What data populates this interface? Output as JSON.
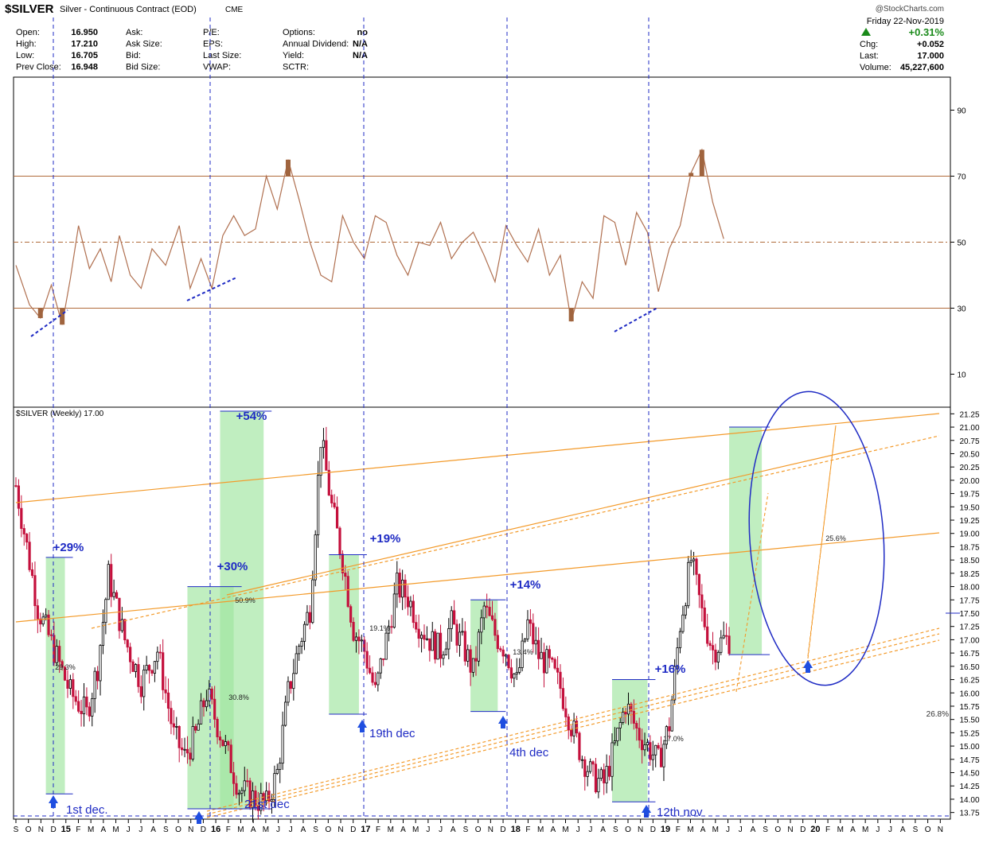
{
  "header": {
    "symbol": "$SILVER",
    "description": "Silver - Continuous Contract (EOD)",
    "exchange": "CME",
    "watermark": "@StockCharts.com",
    "date": "Friday  22-Nov-2019",
    "change_pct": "+0.31%",
    "change_icon": "up-triangle-icon",
    "stats_left": [
      {
        "label": "Open:",
        "value": "16.950"
      },
      {
        "label": "High:",
        "value": "17.210"
      },
      {
        "label": "Low:",
        "value": "16.705"
      },
      {
        "label": "Prev Close:",
        "value": "16.948"
      }
    ],
    "stats_mid": [
      {
        "label": "Ask:",
        "value": ""
      },
      {
        "label": "Ask Size:",
        "value": ""
      },
      {
        "label": "Bid:",
        "value": ""
      },
      {
        "label": "Bid Size:",
        "value": ""
      }
    ],
    "stats_mid2": [
      {
        "label": "P/E:",
        "value": ""
      },
      {
        "label": "EPS:",
        "value": ""
      },
      {
        "label": "Last Size:",
        "value": ""
      },
      {
        "label": "VWAP:",
        "value": ""
      }
    ],
    "stats_mid3": [
      {
        "label": "Options:",
        "value": "no"
      },
      {
        "label": "Annual Dividend:",
        "value": "N/A"
      },
      {
        "label": "Yield:",
        "value": "N/A"
      },
      {
        "label": "SCTR:",
        "value": ""
      }
    ],
    "stats_right": [
      {
        "label": "Chg:",
        "value": "+0.052"
      },
      {
        "label": "Last:",
        "value": "17.000"
      },
      {
        "label": "Volume:",
        "value": "45,227,600"
      }
    ]
  },
  "colors": {
    "rsi_line": "#b07050",
    "orange": "#f39a2a",
    "blue_text": "#1f2bc4",
    "green_box": "#9ee59e",
    "bar_red": "#c4103c",
    "bar_black": "#000000",
    "frame": "#000000"
  },
  "chart_data": [
    {
      "type": "line",
      "name": "rsi_panel",
      "y_ticks": [
        "90",
        "70",
        "50",
        "30",
        "10"
      ],
      "y_tick_values": [
        90,
        70,
        50,
        30,
        10
      ],
      "ylim": [
        0,
        100
      ],
      "overbought": 70,
      "oversold": 30,
      "midline": 50,
      "x": [
        0,
        5,
        9,
        13,
        17,
        20,
        23,
        27,
        31,
        35,
        38,
        42,
        46,
        50,
        55,
        60,
        64,
        68,
        72,
        76,
        80,
        84,
        88,
        92,
        96,
        100,
        104,
        108,
        112,
        116,
        120,
        124,
        128,
        132,
        136,
        140,
        144,
        148,
        152,
        156,
        160,
        164,
        168,
        172,
        176,
        180,
        184,
        188,
        192,
        196,
        200,
        204,
        208,
        212,
        216,
        220,
        224,
        228,
        232,
        236,
        240,
        244,
        248,
        252,
        256,
        260
      ],
      "values": [
        43,
        31,
        27,
        37,
        25,
        39,
        55,
        42,
        48,
        38,
        52,
        40,
        36,
        48,
        43,
        55,
        36,
        45,
        36,
        52,
        58,
        52,
        54,
        70,
        60,
        75,
        63,
        50,
        40,
        38,
        58,
        50,
        45,
        58,
        56,
        46,
        40,
        50,
        49,
        56,
        45,
        50,
        53,
        46,
        38,
        55,
        49,
        44,
        54,
        40,
        46,
        26,
        38,
        33,
        58,
        56,
        43,
        59,
        53,
        35,
        48,
        55,
        71,
        78,
        62,
        51
      ]
    },
    {
      "type": "bar",
      "name": "SILVER weekly price",
      "series_label": "$SILVER (Weekly) 17.00",
      "y_ticks": [
        "21.25",
        "21.00",
        "20.75",
        "20.50",
        "20.25",
        "20.00",
        "19.75",
        "19.50",
        "19.25",
        "19.00",
        "18.75",
        "18.50",
        "18.25",
        "18.00",
        "17.75",
        "17.50",
        "17.25",
        "17.00",
        "16.75",
        "16.50",
        "16.25",
        "16.00",
        "15.75",
        "15.50",
        "15.25",
        "15.00",
        "14.75",
        "14.50",
        "14.25",
        "14.00",
        "13.75"
      ],
      "ylim": [
        13.7,
        21.3
      ],
      "x_ticks": [
        "S",
        "O",
        "N",
        "D",
        "15",
        "F",
        "M",
        "A",
        "M",
        "J",
        "J",
        "A",
        "S",
        "O",
        "N",
        "D",
        "16",
        "F",
        "M",
        "A",
        "M",
        "J",
        "J",
        "A",
        "S",
        "O",
        "N",
        "D",
        "17",
        "F",
        "M",
        "A",
        "M",
        "J",
        "J",
        "A",
        "S",
        "O",
        "N",
        "D",
        "18",
        "F",
        "M",
        "A",
        "M",
        "J",
        "J",
        "A",
        "S",
        "O",
        "N",
        "D",
        "19",
        "F",
        "M",
        "A",
        "M",
        "J",
        "J",
        "A",
        "S",
        "O",
        "N",
        "D",
        "20",
        "F",
        "M",
        "A",
        "M",
        "J",
        "J",
        "A",
        "S",
        "O",
        "N"
      ],
      "weeks": [
        0,
        8,
        14,
        20,
        26,
        30,
        34,
        40,
        46,
        52,
        58,
        62,
        66,
        70,
        76,
        82,
        88,
        92,
        96,
        100,
        104,
        108,
        112,
        116,
        120,
        124,
        128,
        132,
        136,
        140,
        144,
        148,
        152,
        156,
        160,
        164,
        168,
        172,
        176,
        180,
        184,
        188,
        192,
        196,
        200,
        204,
        208,
        212,
        216,
        220,
        224,
        228,
        232,
        236,
        240,
        244,
        248,
        252,
        256,
        260,
        262
      ],
      "close": [
        19.9,
        17.6,
        16.8,
        16.0,
        15.6,
        16.5,
        18.2,
        17.0,
        16.2,
        16.8,
        15.2,
        14.8,
        15.2,
        16.0,
        15.1,
        14.2,
        14.0,
        13.9,
        14.5,
        16.0,
        16.9,
        17.6,
        20.8,
        19.5,
        18.5,
        17.2,
        16.8,
        16.0,
        17.0,
        18.0,
        17.8,
        17.3,
        17.0,
        16.8,
        17.3,
        16.9,
        16.4,
        17.6,
        17.1,
        16.8,
        16.2,
        17.3,
        16.7,
        16.5,
        16.1,
        15.4,
        14.8,
        14.4,
        14.3,
        15.0,
        15.8,
        15.3,
        15.0,
        14.7,
        15.4,
        17.3,
        18.5,
        17.5,
        16.8,
        17.0,
        17.0
      ],
      "measure_boxes": [
        {
          "label": "+29%",
          "inner": "29.3%",
          "marker": "1st dec.",
          "start_week": 11,
          "end_week": 18,
          "low": 14.1,
          "high": 18.55
        },
        {
          "label": "+30%",
          "inner": "30.8%",
          "marker": "21st dec",
          "start_week": 63,
          "end_week": 80,
          "low": 13.82,
          "high": 18.0
        },
        {
          "label": "+54%",
          "inner": "50.9%",
          "marker": "",
          "start_week": 75,
          "end_week": 91,
          "low": 13.82,
          "high": 21.3
        },
        {
          "label": "+19%",
          "inner": "19.1%",
          "marker": "19th dec",
          "start_week": 115,
          "end_week": 126,
          "low": 15.6,
          "high": 18.6
        },
        {
          "label": "+14%",
          "inner": "13.4%",
          "marker": "4th dec",
          "start_week": 167,
          "end_week": 177,
          "low": 15.65,
          "high": 17.75
        },
        {
          "label": "+16%",
          "inner": "17.0%",
          "marker": "12th nov",
          "start_week": 219,
          "end_week": 232,
          "low": 13.95,
          "high": 16.25
        },
        {
          "label": "",
          "inner": "25.6%",
          "marker": "",
          "start_week": 262,
          "end_week": 274,
          "low": 16.72,
          "high": 21.0
        }
      ],
      "right_label": "26.8%"
    }
  ]
}
